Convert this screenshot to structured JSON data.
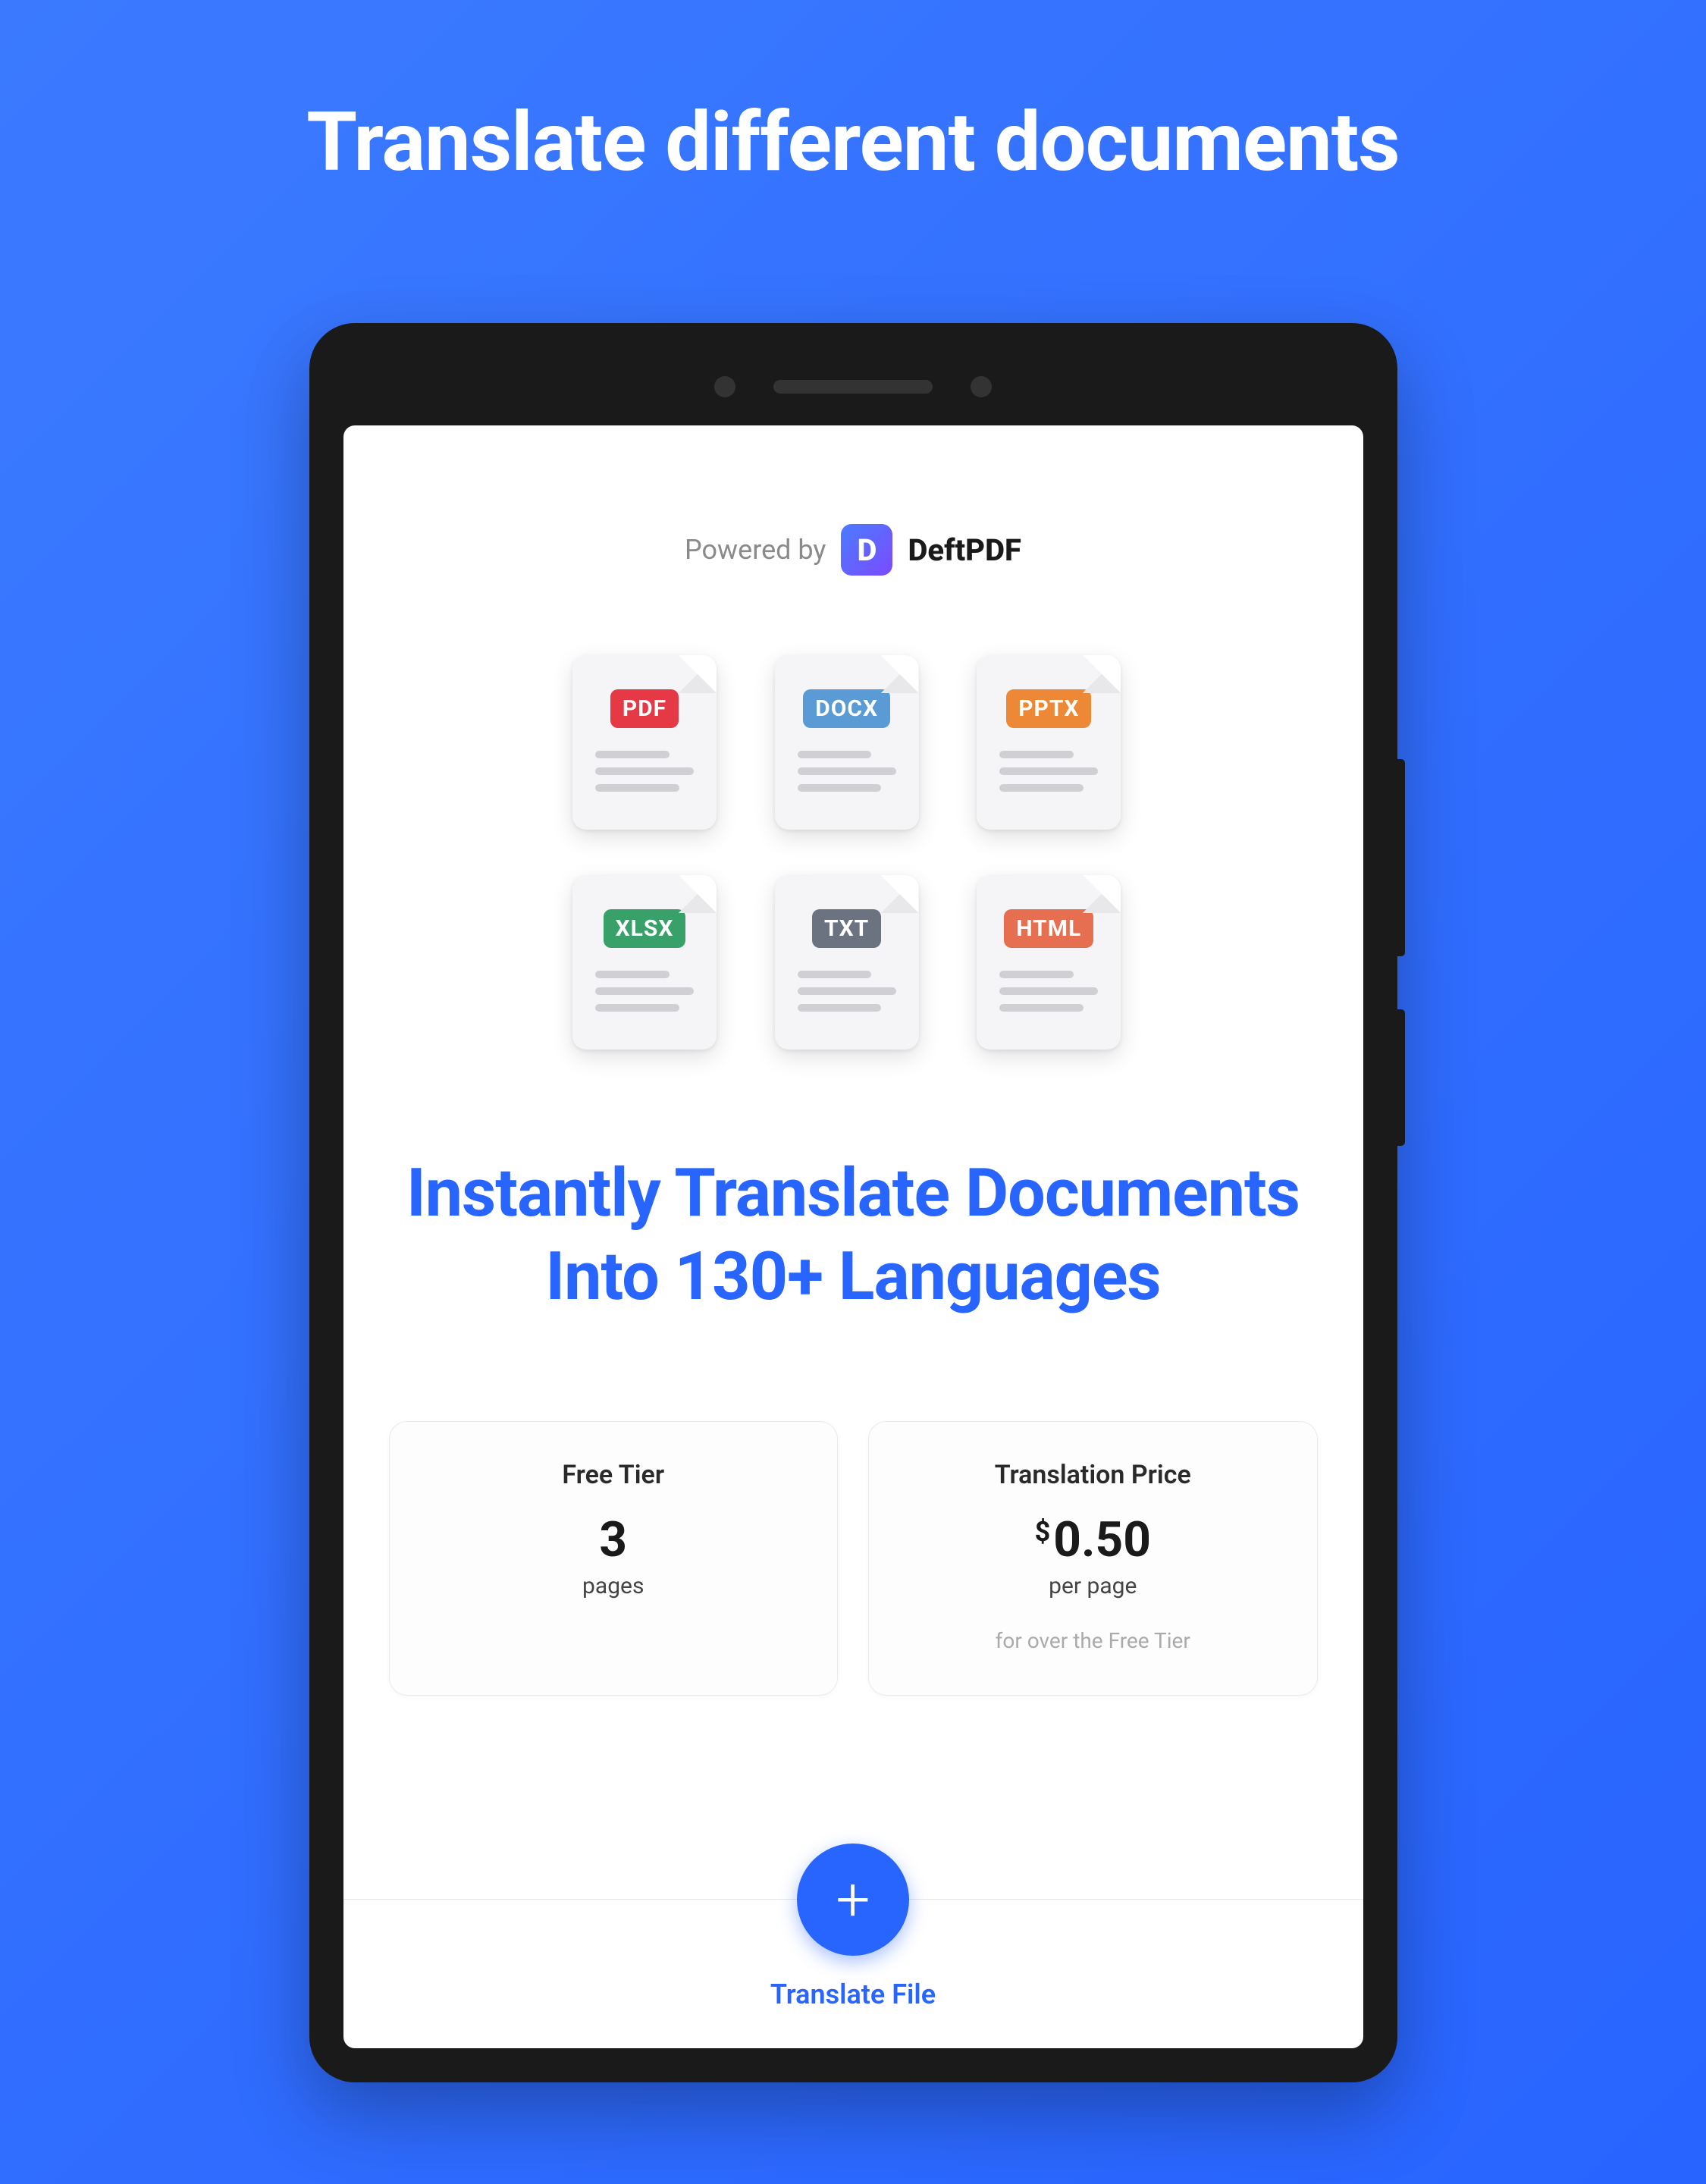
{
  "page": {
    "title": "Translate different documents"
  },
  "powered": {
    "label": "Powered by",
    "brand": "DeftPDF",
    "logo_letter": "D"
  },
  "file_types": {
    "pdf": "PDF",
    "docx": "DOCX",
    "pptx": "PPTX",
    "xlsx": "XLSX",
    "txt": "TXT",
    "html": "HTML"
  },
  "heading": "Instantly Translate Documents Into 130+ Languages",
  "pricing": {
    "free": {
      "title": "Free Tier",
      "value": "3",
      "unit": "pages"
    },
    "paid": {
      "title": "Translation Price",
      "currency": "$",
      "value": "0.50",
      "unit": "per page",
      "note": "for over the Free Tier"
    }
  },
  "cta": {
    "label": "Translate File"
  }
}
